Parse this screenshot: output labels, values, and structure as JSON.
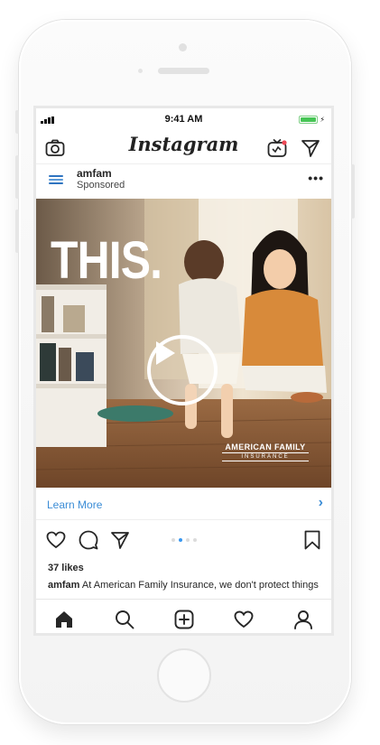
{
  "status_bar": {
    "time": "9:41 AM"
  },
  "app": {
    "logo_text": "Instagram"
  },
  "post": {
    "account": "amfam",
    "subtitle": "Sponsored",
    "overlay_text": "THIS.",
    "brand_watermark_line1": "AMERICAN FAMILY",
    "brand_watermark_line2": "INSURANCE",
    "cta_label": "Learn More",
    "likes": "37 likes",
    "caption_user": "amfam",
    "caption_text": "At American Family Insurance, we don't protect things"
  },
  "icons": {
    "header": [
      "camera-icon",
      "igtv-icon",
      "direct-message-icon"
    ],
    "actions": [
      "heart-icon",
      "comment-icon",
      "share-icon",
      "bookmark-icon"
    ],
    "tabs": [
      "home-icon",
      "search-icon",
      "add-post-icon",
      "activity-heart-icon",
      "profile-icon"
    ]
  },
  "colors": {
    "link_blue": "#3c8dd6",
    "active_dot": "#3897f0",
    "battery_green": "#46c555",
    "brand_logo_blue": "#2f74c0"
  },
  "carousel": {
    "total": 4,
    "active_index": 1
  }
}
